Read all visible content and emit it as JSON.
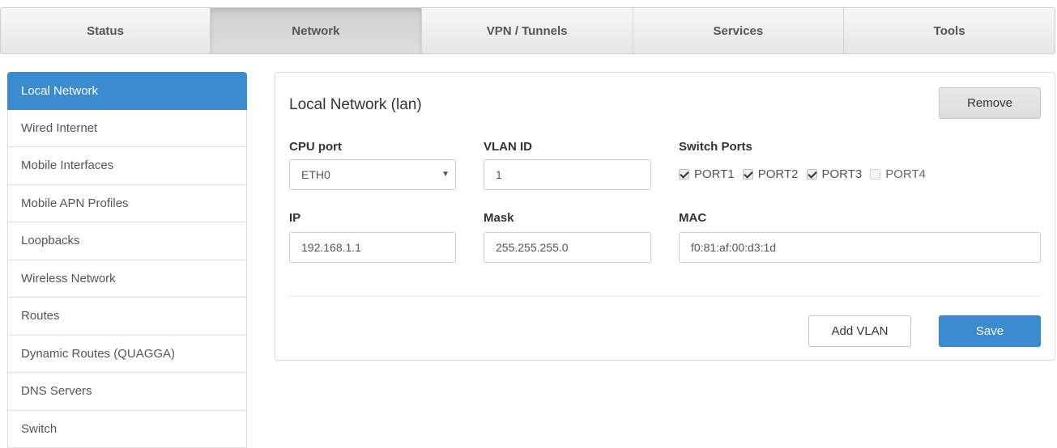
{
  "topnav": {
    "tabs": [
      {
        "label": "Status"
      },
      {
        "label": "Network",
        "active": true
      },
      {
        "label": "VPN / Tunnels"
      },
      {
        "label": "Services"
      },
      {
        "label": "Tools"
      }
    ]
  },
  "sidebar": {
    "items": [
      {
        "label": "Local Network",
        "active": true
      },
      {
        "label": "Wired Internet"
      },
      {
        "label": "Mobile Interfaces"
      },
      {
        "label": "Mobile APN Profiles"
      },
      {
        "label": "Loopbacks"
      },
      {
        "label": "Wireless Network"
      },
      {
        "label": "Routes"
      },
      {
        "label": "Dynamic Routes (QUAGGA)"
      },
      {
        "label": "DNS Servers"
      },
      {
        "label": "Switch"
      }
    ]
  },
  "panel": {
    "title": "Local Network (lan)",
    "remove_label": "Remove",
    "cpu_port": {
      "label": "CPU port",
      "value": "ETH0"
    },
    "vlan_id": {
      "label": "VLAN ID",
      "value": "1"
    },
    "switch_ports": {
      "label": "Switch Ports",
      "ports": [
        {
          "label": "PORT1",
          "checked": true
        },
        {
          "label": "PORT2",
          "checked": true
        },
        {
          "label": "PORT3",
          "checked": true
        },
        {
          "label": "PORT4",
          "checked": false
        }
      ]
    },
    "ip": {
      "label": "IP",
      "value": "192.168.1.1"
    },
    "mask": {
      "label": "Mask",
      "value": "255.255.255.0"
    },
    "mac": {
      "label": "MAC",
      "value": "f0:81:af:00:d3:1d"
    },
    "add_vlan_label": "Add VLAN",
    "save_label": "Save"
  },
  "colors": {
    "accent": "#3b8bd0",
    "border": "#dddddd"
  },
  "icons": {
    "select_caret": "caret-down-icon",
    "checkbox": "checkbox-icon"
  }
}
